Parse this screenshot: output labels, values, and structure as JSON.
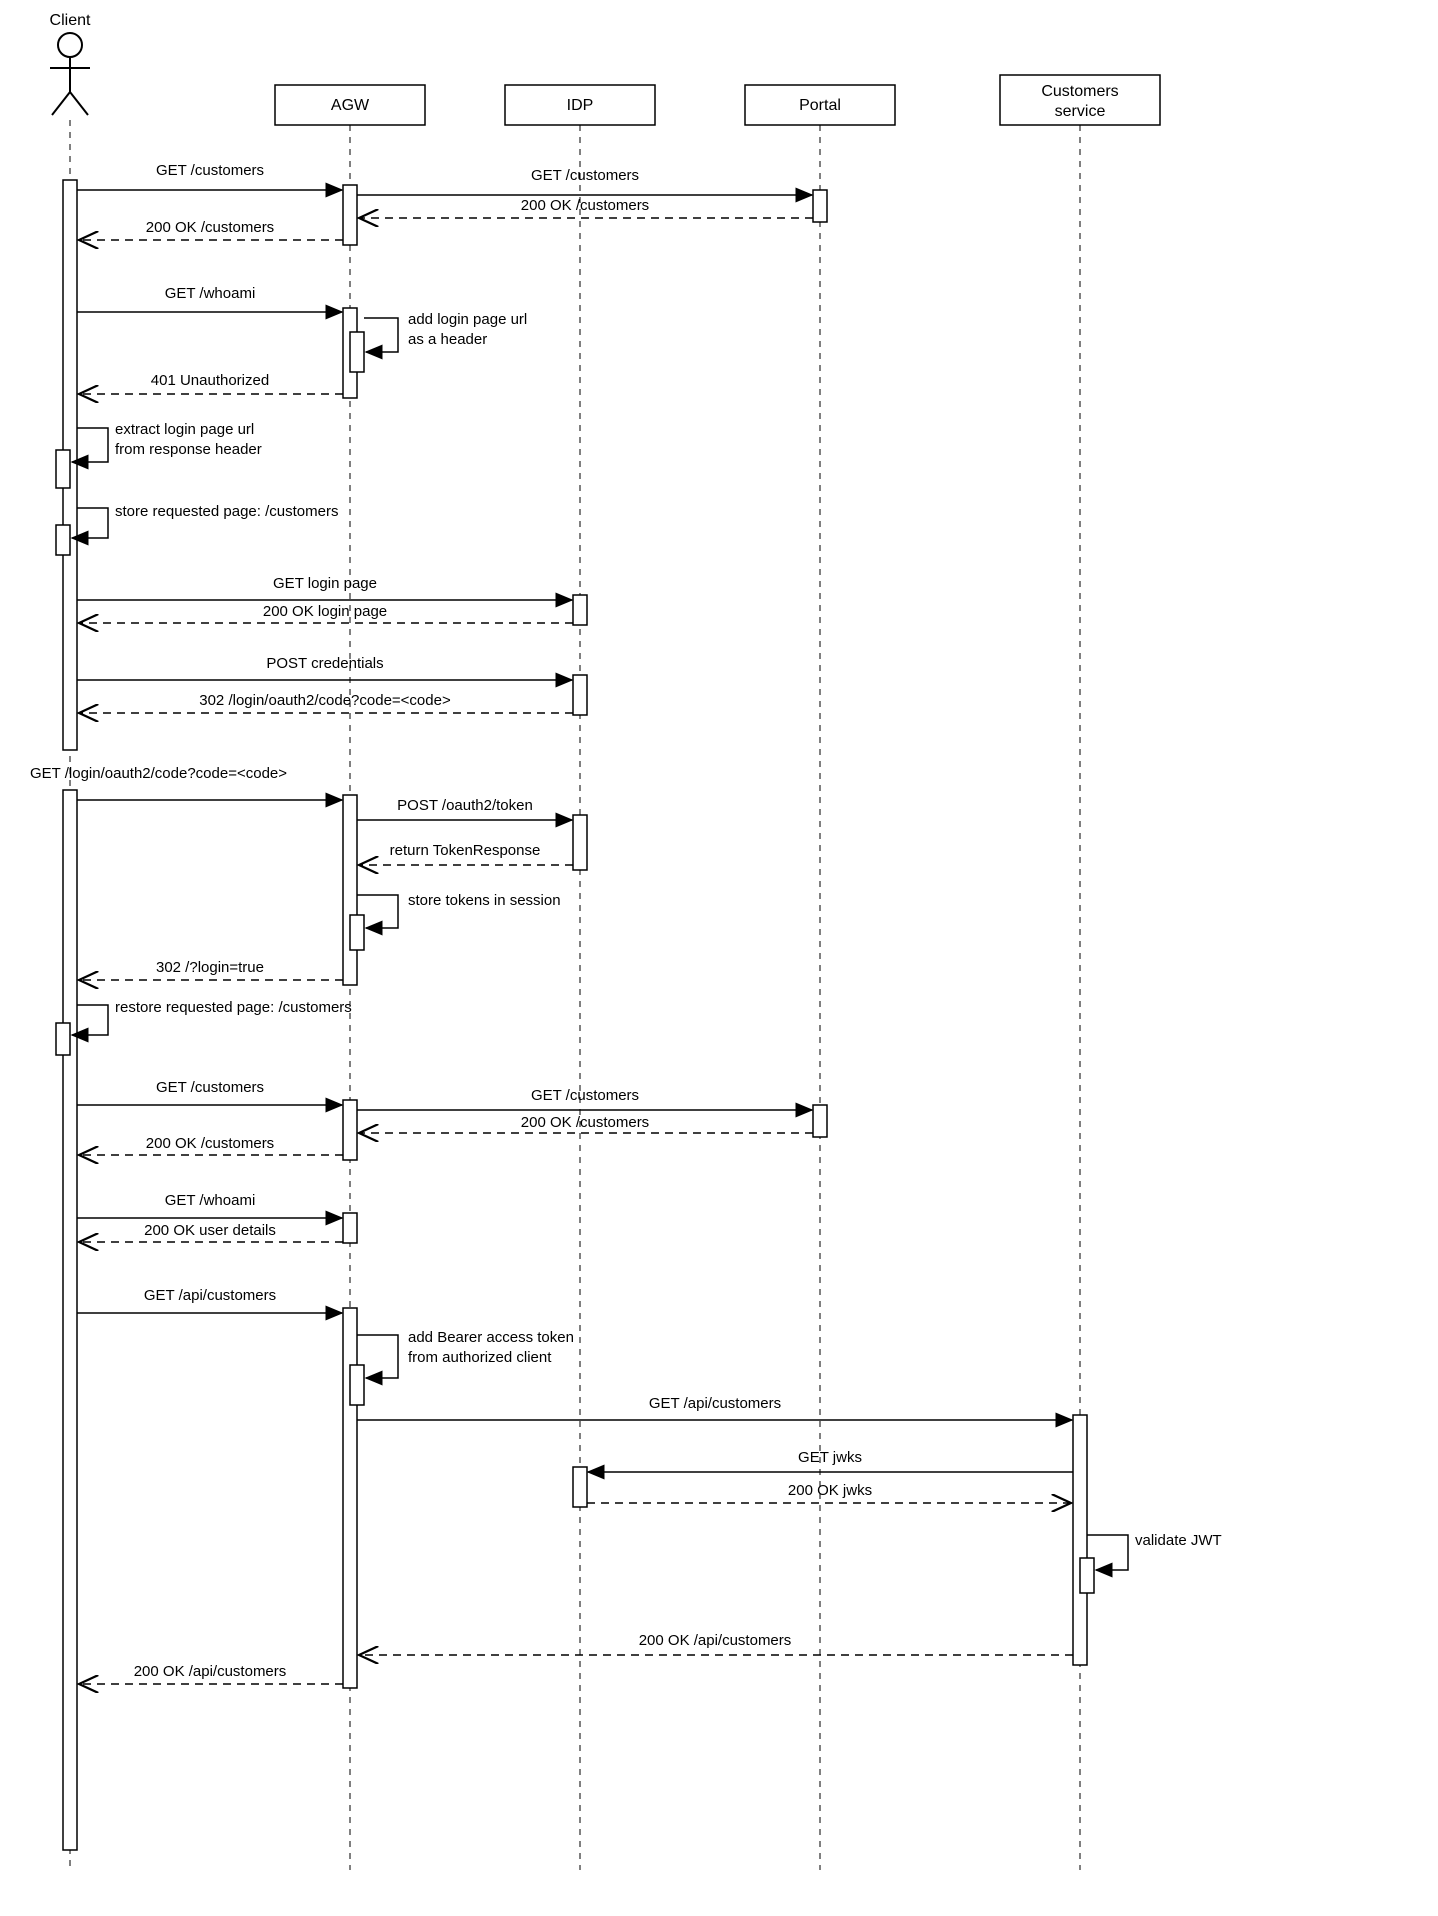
{
  "participants": {
    "client": "Client",
    "agw": "AGW",
    "idp": "IDP",
    "portal": "Portal",
    "customers": "Customers",
    "service": "service"
  },
  "labels": {
    "m1": "GET /customers",
    "m2": "GET /customers",
    "m3": "200 OK /customers",
    "m4": "200 OK /customers",
    "m5": "GET /whoami",
    "m6a": "add login page url",
    "m6b": "as a header",
    "m7": "401 Unauthorized",
    "m8a": "extract login page url",
    "m8b": "from response header",
    "m9": "store requested page: /customers",
    "m10": "GET login page",
    "m11": "200 OK login page",
    "m12": "POST credentials",
    "m13": "302 /login/oauth2/code?code=<code>",
    "m14": "GET /login/oauth2/code?code=<code>",
    "m15": "POST /oauth2/token",
    "m16": "return TokenResponse",
    "m17": "store tokens in session",
    "m18": "302 /?login=true",
    "m19": "restore requested page: /customers",
    "m20": "GET /customers",
    "m21": "GET /customers",
    "m22": "200 OK /customers",
    "m23": "200 OK /customers",
    "m24": "GET /whoami",
    "m25": "200 OK user details",
    "m26": "GET /api/customers",
    "m27a": "add Bearer access token",
    "m27b": "from authorized client",
    "m28": "GET /api/customers",
    "m29": "GET jwks",
    "m30": "200 OK jwks",
    "m31": "validate JWT",
    "m32": "200 OK /api/customers",
    "m33": "200 OK /api/customers"
  }
}
